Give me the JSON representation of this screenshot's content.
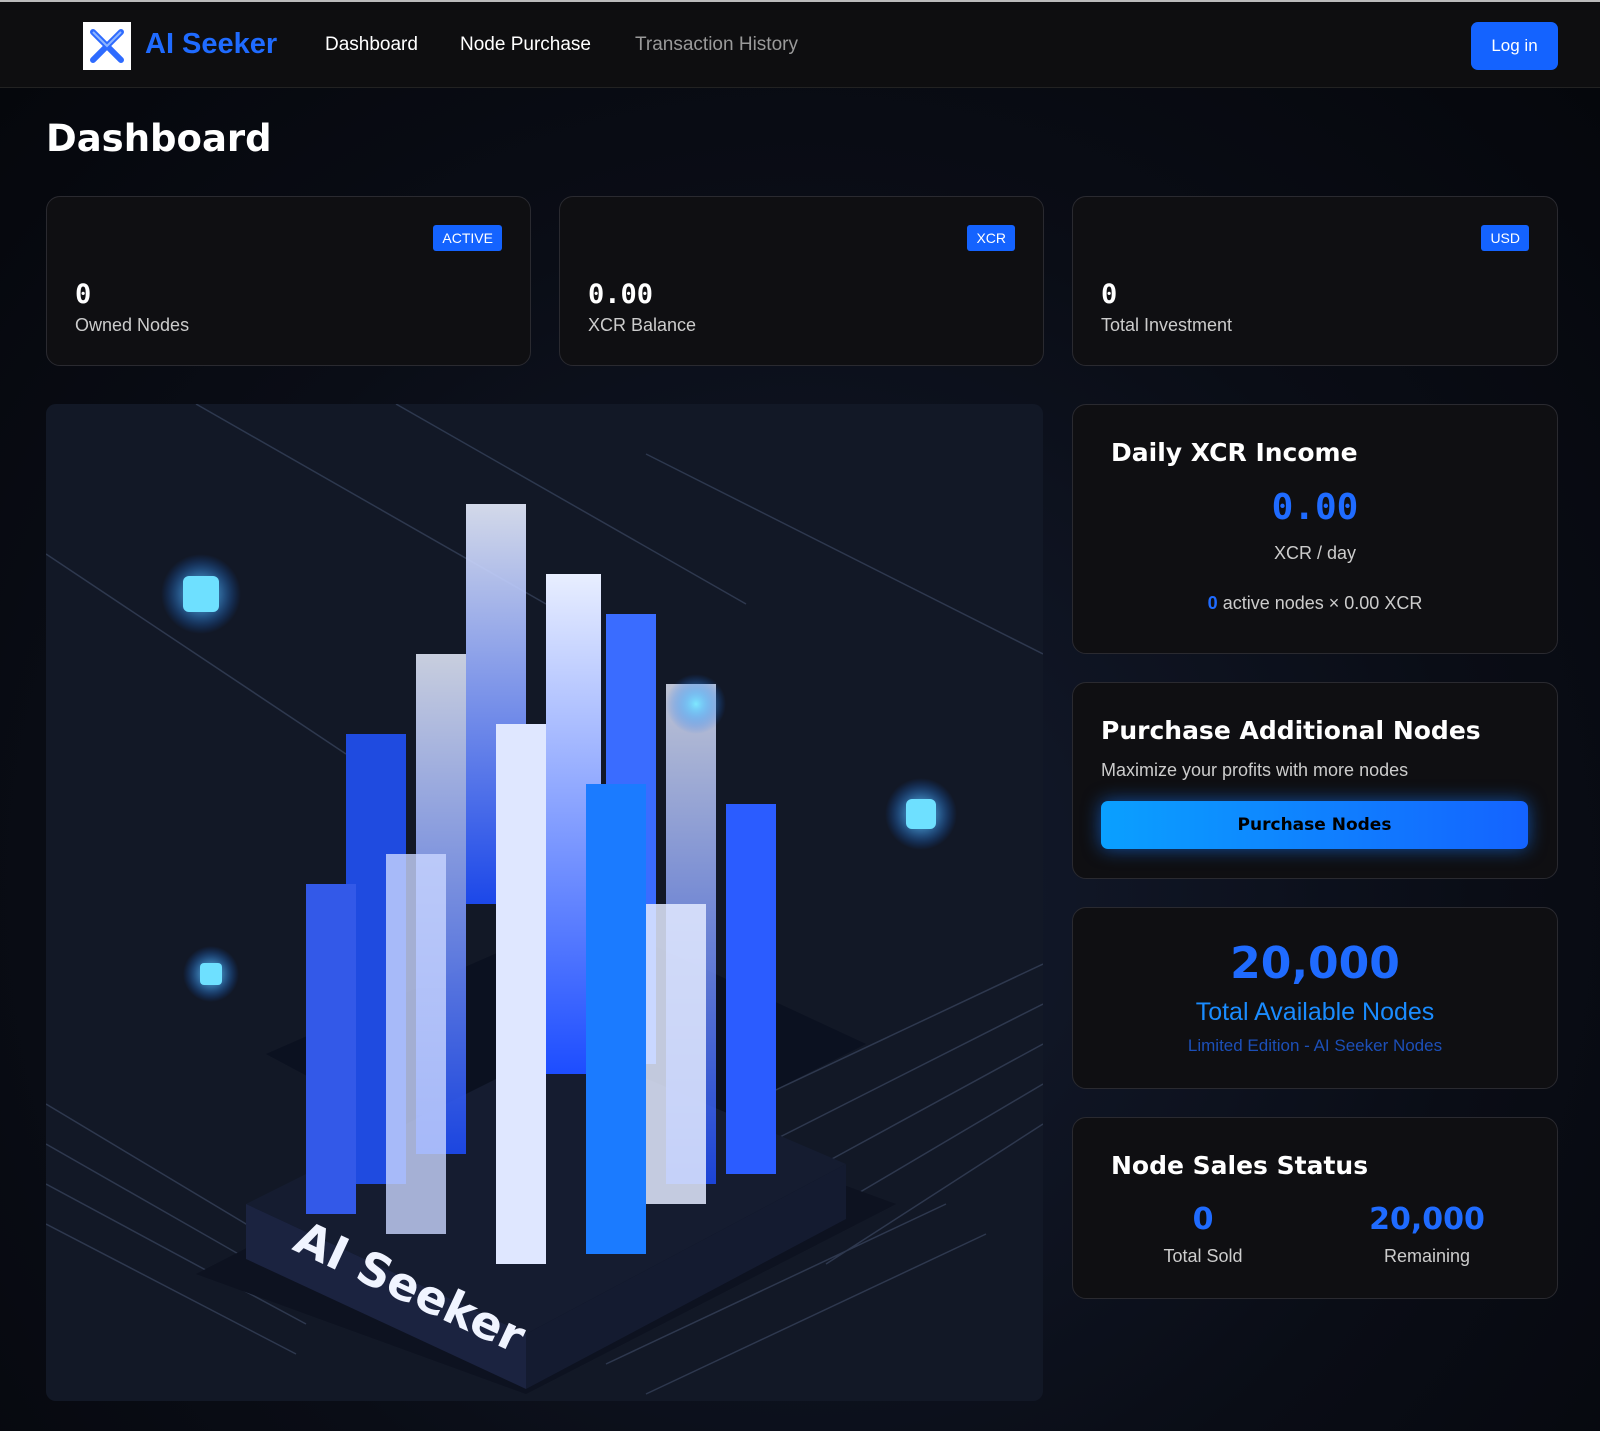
{
  "nav": {
    "brand": "AI Seeker",
    "links": [
      "Dashboard",
      "Node Purchase",
      "Transaction History"
    ],
    "login": "Log in"
  },
  "page_title": "Dashboard",
  "stats": [
    {
      "badge": "ACTIVE",
      "value": "0",
      "label": "Owned Nodes"
    },
    {
      "badge": "XCR",
      "value": "0.00",
      "label": "XCR Balance"
    },
    {
      "badge": "USD",
      "value": "0",
      "label": "Total Investment"
    }
  ],
  "hero": {
    "label": "AI Seeker"
  },
  "daily": {
    "title": "Daily XCR Income",
    "value": "0.00",
    "unit": "XCR / day",
    "active_count": "0",
    "formula": "active nodes × 0.00 XCR"
  },
  "purchase": {
    "title": "Purchase Additional Nodes",
    "subtitle": "Maximize your profits with more nodes",
    "button": "Purchase Nodes"
  },
  "available": {
    "value": "20,000",
    "title": "Total Available Nodes",
    "subtitle": "Limited Edition - AI Seeker Nodes"
  },
  "sales": {
    "title": "Node Sales Status",
    "sold": "0",
    "sold_label": "Total Sold",
    "remaining": "20,000",
    "remaining_label": "Remaining"
  },
  "colors": {
    "accent": "#1463ff"
  }
}
